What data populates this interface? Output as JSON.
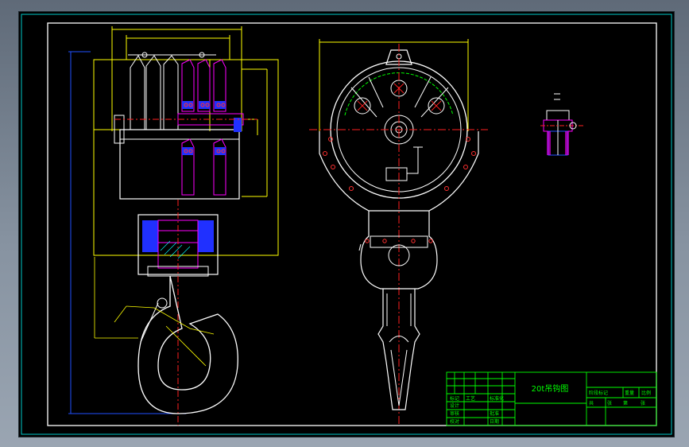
{
  "title_block": {
    "drawing_title": "20t吊钩图",
    "row_labels": [
      "标记",
      "设计",
      "审核",
      "校对",
      "工艺"
    ],
    "mid_labels": [
      "标准化",
      "批准",
      "日期"
    ],
    "right_labels": [
      "阶段标记",
      "重量",
      "比例",
      "共",
      "张",
      "第",
      "张"
    ]
  },
  "colors": {
    "frame": "#ffffff",
    "outline": "#ffffff",
    "dimension": "#ffff00",
    "centerline": "#ff2020",
    "hidden": "#0000ff",
    "section": "#ff00ff",
    "hatch": "#00ffff",
    "titleblock": "#00ff00"
  }
}
